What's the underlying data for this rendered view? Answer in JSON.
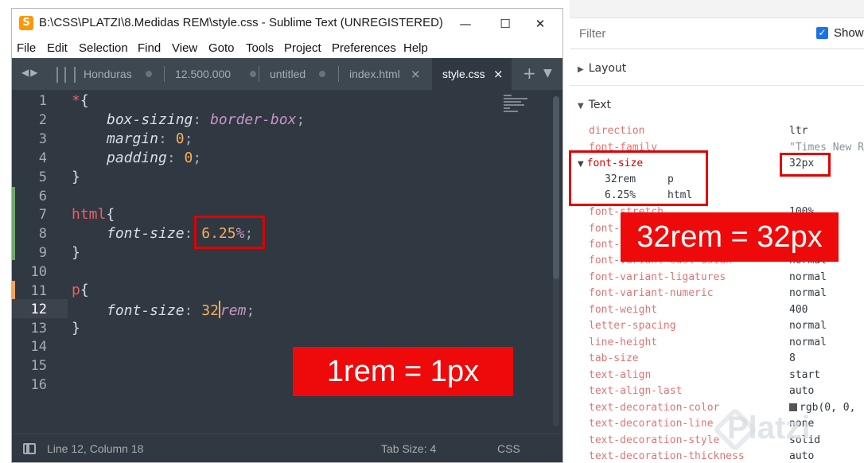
{
  "window": {
    "title": "B:\\CSS\\PLATZI\\8.Medidas REM\\style.css - Sublime Text (UNREGISTERED)",
    "minimize": "—",
    "maximize": "☐",
    "close": "✕"
  },
  "menu": [
    "File",
    "Edit",
    "Selection",
    "Find",
    "View",
    "Goto",
    "Tools",
    "Project",
    "Preferences",
    "Help"
  ],
  "tabs": [
    {
      "label": "Honduras"
    },
    {
      "label": "12.500.000"
    },
    {
      "label": "untitled"
    },
    {
      "label": "index.html",
      "close": "×"
    },
    {
      "label": "style.css",
      "close": "×",
      "active": true
    }
  ],
  "tabbar": {
    "nav": "◀▶",
    "plus": "+",
    "caret": "▼"
  },
  "editor": {
    "line_numbers": [
      "1",
      "2",
      "3",
      "4",
      "5",
      "6",
      "7",
      "8",
      "9",
      "10",
      "11",
      "12",
      "13",
      "14",
      "15",
      "16"
    ],
    "code": {
      "l1_sel": "*",
      "l1_brace": "{",
      "l2_prop": "box-sizing",
      "l2_val": "border-box",
      "l3_prop": "margin",
      "l3_num": "0",
      "l4_prop": "padding",
      "l4_num": "0",
      "l5_brace": "}",
      "l7_sel": "html",
      "l7_brace": "{",
      "l8_prop": "font-size",
      "l8_num": "6.25",
      "l8_unit": "%",
      "l9_brace": "}",
      "l11_sel": "p",
      "l11_brace": "{",
      "l12_prop": "font-size",
      "l12_num": "32",
      "l12_unit": "rem",
      "l13_brace": "}",
      "colon": ":",
      "semi": ";"
    }
  },
  "status": {
    "position": "Line 12, Column 18",
    "tab_size": "Tab Size: 4",
    "syntax": "CSS"
  },
  "devtools": {
    "filter_placeholder": "Filter",
    "show_label": "Show",
    "sections": {
      "layout": "Layout",
      "text": "Text"
    },
    "properties": [
      {
        "name": "direction",
        "value": "ltr"
      },
      {
        "name": "font-family",
        "value": "\"Times New R"
      },
      {
        "name": "font-size",
        "value": "32px"
      },
      {
        "name": "font-stretch",
        "value": "100%"
      },
      {
        "name": "font-variant-ligatures",
        "value": "normal"
      },
      {
        "name": "font-variant-numeric",
        "value": "normal"
      },
      {
        "name": "font-weight",
        "value": "400"
      },
      {
        "name": "letter-spacing",
        "value": "normal"
      },
      {
        "name": "line-height",
        "value": "normal"
      },
      {
        "name": "tab-size",
        "value": "8"
      },
      {
        "name": "text-align",
        "value": "start"
      },
      {
        "name": "text-align-last",
        "value": "auto"
      },
      {
        "name": "text-decoration-color",
        "value": "rgb(0, 0,"
      },
      {
        "name": "text-decoration-line",
        "value": "none"
      },
      {
        "name": "text-decoration-style",
        "value": "solid"
      },
      {
        "name": "text-decoration-thickness",
        "value": "auto"
      }
    ],
    "partial_props": [
      "font-",
      "font-",
      "font-variant-east-asian"
    ],
    "partial_values": [
      "normal"
    ],
    "font_size_sources": [
      {
        "value": "32rem",
        "selector": "p"
      },
      {
        "value": "6.25%",
        "selector": "html"
      }
    ]
  },
  "annotations": {
    "banner_rem": "1rem = 1px",
    "banner_px": "32rem = 32px"
  },
  "watermark": "Platzi",
  "colors": {
    "editor_bg": "#303841",
    "selector": "#ec5f66",
    "number": "#f9ae58",
    "value": "#c594c5",
    "highlight_red": "#ee0a0a"
  }
}
